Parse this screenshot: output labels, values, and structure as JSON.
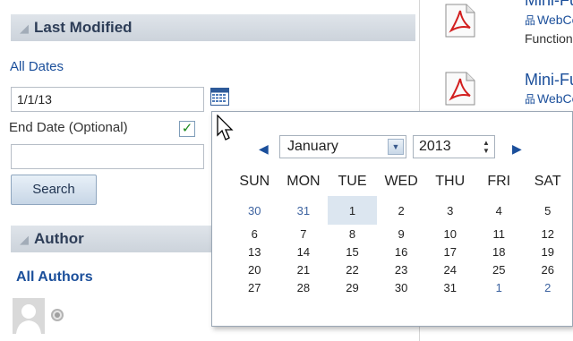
{
  "left": {
    "last_modified_header": "Last Modified",
    "all_dates_link": "All Dates",
    "start_date_value": "1/1/13",
    "end_date_label": "End Date (Optional)",
    "end_date_checked": true,
    "end_date_value": "",
    "search_button": "Search",
    "author_header": "Author",
    "all_authors_link": "All Authors"
  },
  "results": [
    {
      "title": "Mini-Fun",
      "sub": "WebCe",
      "desc": "Functiona"
    },
    {
      "title": "Mini-Fun",
      "sub": "WebCe"
    }
  ],
  "calendar": {
    "month": "January",
    "year": "2013",
    "day_headers": [
      "SUN",
      "MON",
      "TUE",
      "WED",
      "THU",
      "FRI",
      "SAT"
    ],
    "weeks": [
      [
        "30",
        "31",
        "1",
        "2",
        "3",
        "4",
        "5"
      ],
      [
        "6",
        "7",
        "8",
        "9",
        "10",
        "11",
        "12"
      ],
      [
        "13",
        "14",
        "15",
        "16",
        "17",
        "18",
        "19"
      ],
      [
        "20",
        "21",
        "22",
        "23",
        "24",
        "25",
        "26"
      ],
      [
        "27",
        "28",
        "29",
        "30",
        "31",
        "1",
        "2"
      ]
    ],
    "selected_day": "1"
  },
  "icons": {
    "calendar": "calendar-icon",
    "pdf": "pdf-file-icon",
    "webcenter": "webcenter-grid-icon",
    "cursor": "mouse-pointer-icon",
    "prev": "prev-month-arrow-icon",
    "next": "next-month-arrow-icon"
  },
  "colors": {
    "link": "#1b4f9b",
    "header_bg": "#d4dae1",
    "checkbox": "#1a8a1a",
    "selected_day": "#dce6f0"
  }
}
